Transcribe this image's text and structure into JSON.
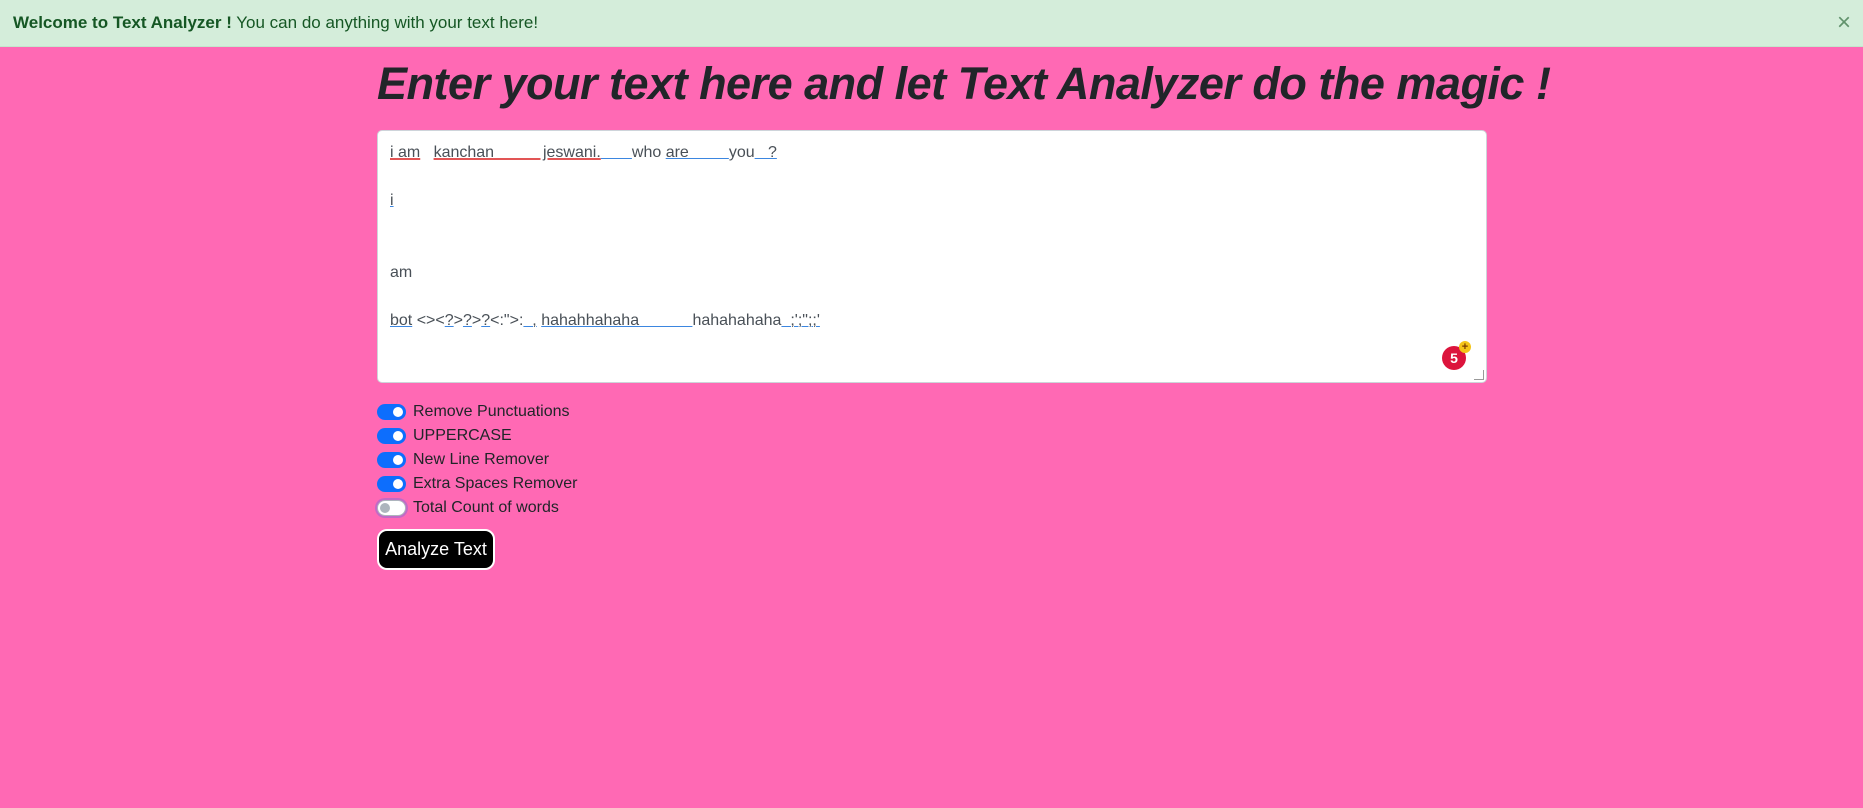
{
  "alert": {
    "strong": "Welcome to Text Analyzer !",
    "message": " You can do anything with your text here!",
    "close": "×"
  },
  "heading": "Enter your text here and let Text Analyzer do the magic !",
  "textarea": {
    "line1_a": "i am",
    "line1_b": "   ",
    "line1_c": "kanchan           jeswani.",
    "line1_d": "       ",
    "line1_e": "who ",
    "line1_f": "are         ",
    "line1_g": "you",
    "line1_h": "   ?",
    "line2": "",
    "line3": "i",
    "line4": "",
    "line5": "",
    "line6": "am",
    "line7": "",
    "line8_a": "bot",
    "line8_b": " <><",
    "line8_c": "?",
    "line8_d": ">",
    "line8_e": "?",
    "line8_f": ">",
    "line8_g": "?",
    "line8_h": "<:\">:",
    "line8_i": "  ,",
    "line8_j": " ",
    "line8_k": "hahahhahaha            ",
    "line8_l": "hahahahaha",
    "line8_m": "  ;';\";;'"
  },
  "grammar_badge": {
    "count": "5",
    "plus": "+"
  },
  "switches": [
    {
      "label": "Remove Punctuations",
      "checked": true
    },
    {
      "label": "UPPERCASE",
      "checked": true
    },
    {
      "label": "New Line Remover",
      "checked": true
    },
    {
      "label": "Extra Spaces Remover",
      "checked": true
    },
    {
      "label": "Total Count of words",
      "checked": false
    }
  ],
  "analyze_button": "Analyze Text",
  "colors": {
    "background": "#ff69b4",
    "alert_bg": "#d4edda",
    "alert_text": "#155724",
    "switch_on": "#0d6efd",
    "button_bg": "#000000",
    "badge": "#dc143c"
  }
}
